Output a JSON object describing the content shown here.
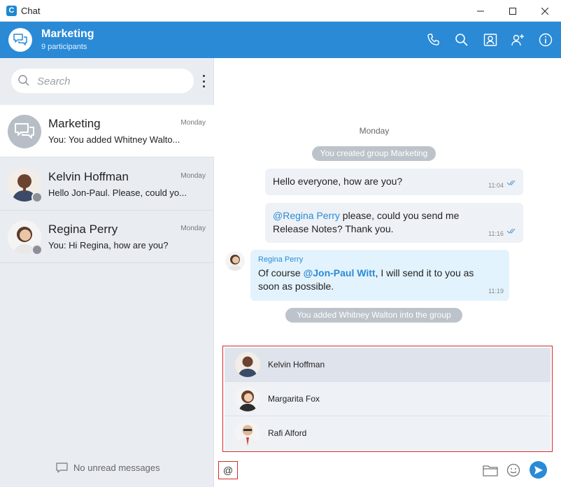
{
  "window": {
    "app_logo": "C",
    "title": "Chat"
  },
  "header": {
    "title": "Marketing",
    "subtitle": "9 participants",
    "icons": [
      "phone-icon",
      "search-icon",
      "contact-card-icon",
      "add-user-icon",
      "info-icon"
    ]
  },
  "sidebar": {
    "search_placeholder": "Search",
    "conversations": [
      {
        "name": "Marketing",
        "preview": "You: You added Whitney Walto...",
        "time": "Monday",
        "active": true
      },
      {
        "name": "Kelvin Hoffman",
        "preview": "Hello Jon-Paul. Please, could yo...",
        "time": "Monday",
        "active": false
      },
      {
        "name": "Regina Perry",
        "preview": "You: Hi Regina, how are you?",
        "time": "Monday",
        "active": false
      }
    ],
    "no_unread": "No unread messages"
  },
  "chat": {
    "date_separator": "Monday",
    "system_created": "You created group Marketing",
    "messages": [
      {
        "text": "Hello everyone, how are you?",
        "time": "11:04"
      },
      {
        "mention": "@Regina Perry",
        "text_line1": " please, could you send me",
        "text_line2": "Release Notes? Thank you.",
        "time": "11:16"
      },
      {
        "sender": "Regina Perry",
        "text_before": "Of course ",
        "mention": "@Jon-Paul Witt",
        "text_after": ", I will send it to you as",
        "text_line2": "soon as possible.",
        "time": "11:19"
      }
    ],
    "system_added": "You added Whitney Walton into the group"
  },
  "mention_popup": {
    "items": [
      {
        "name": "Kelvin Hoffman",
        "highlighted": true
      },
      {
        "name": "Margarita Fox",
        "highlighted": false
      },
      {
        "name": "Rafi Alford",
        "highlighted": false
      }
    ]
  },
  "composer": {
    "value": "@"
  },
  "colors": {
    "accent": "#2a8ad6",
    "sidebar_bg": "#e9edf2",
    "outgoing_bubble": "#eef1f6",
    "incoming_bubble": "#e3f3fd",
    "highlight_border": "#d42b2b"
  }
}
